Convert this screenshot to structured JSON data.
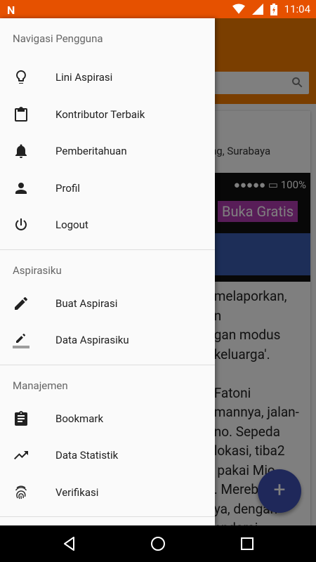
{
  "status_bar": {
    "time": "11:04",
    "brand_icon": "n-logo-icon"
  },
  "background": {
    "location_text": "ng, Surabaya",
    "battery_text": "●●●●● ▭ 100%",
    "promo_button": "Buka Gratis",
    "article_text": " melaporkan,\n n\n gan modus\n keluarga'.\n\n Fatoni\n mannya, jalan-\n no. Sepeda\n lokasi, tiba2\n  pakai Mio\n . Mereb\n ya, dengan\n endarai",
    "fab_label": "+"
  },
  "drawer": {
    "sections": [
      {
        "title": "Navigasi Pengguna",
        "items": [
          {
            "label": "Lini Aspirasi",
            "icon": "lightbulb-icon"
          },
          {
            "label": "Kontributor Terbaik",
            "icon": "clipboard-icon"
          },
          {
            "label": "Pemberitahuan",
            "icon": "bell-icon"
          },
          {
            "label": "Profil",
            "icon": "person-icon"
          },
          {
            "label": "Logout",
            "icon": "power-icon"
          }
        ]
      },
      {
        "title": "Aspirasiku",
        "items": [
          {
            "label": "Buat Aspirasi",
            "icon": "pencil-icon"
          },
          {
            "label": "Data Aspirasiku",
            "icon": "pencil-underline-icon"
          }
        ]
      },
      {
        "title": "Manajemen",
        "items": [
          {
            "label": "Bookmark",
            "icon": "assignment-icon"
          },
          {
            "label": "Data Statistik",
            "icon": "trending-up-icon"
          },
          {
            "label": "Verifikasi",
            "icon": "fingerprint-icon"
          }
        ]
      }
    ]
  },
  "nav_bar": {
    "buttons": [
      "back-icon",
      "home-icon",
      "recents-icon"
    ]
  },
  "colors": {
    "status_bar": "#e65100",
    "app_bar": "#f57c00",
    "fab": "#3f51b5",
    "drawer_bg": "#fafafa"
  }
}
